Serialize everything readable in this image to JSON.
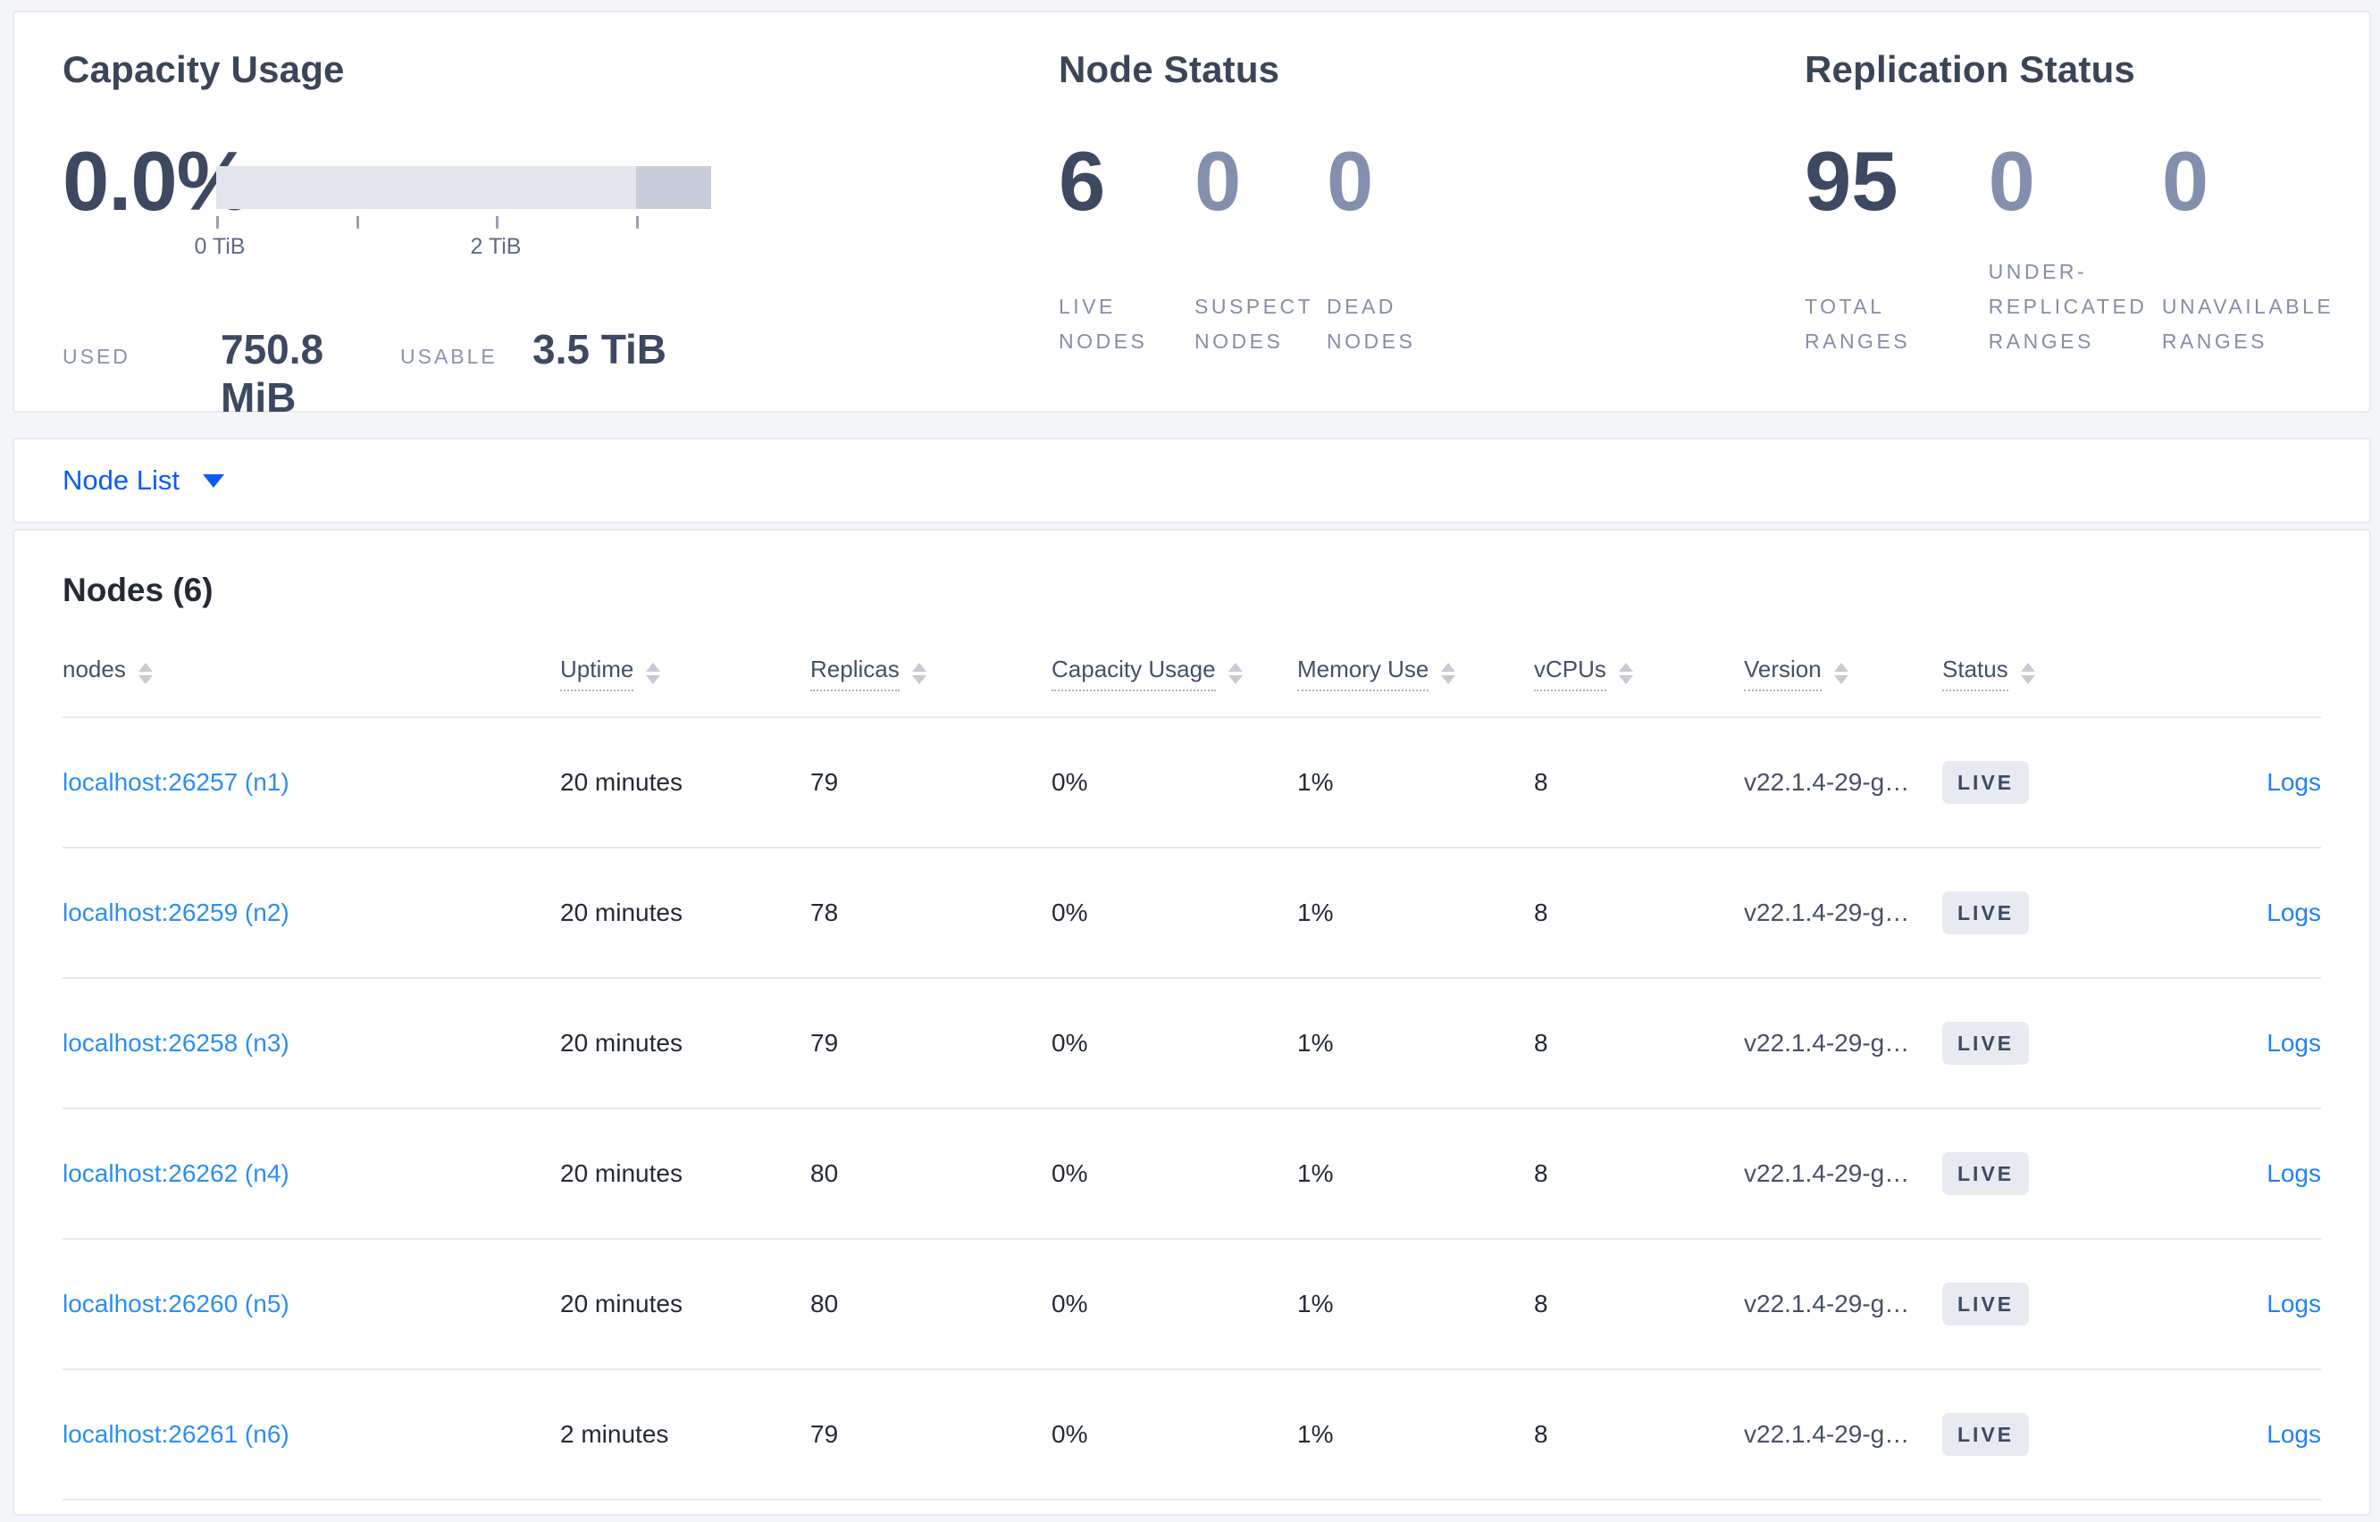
{
  "summary": {
    "capacity": {
      "title": "Capacity Usage",
      "percent": "0.0%",
      "axis_labels": [
        "0 TiB",
        "2 TiB"
      ],
      "used_label": "USED",
      "used_value": "750.8 MiB",
      "usable_label": "USABLE",
      "usable_value": "3.5 TiB"
    },
    "node_status": {
      "title": "Node Status",
      "stats": [
        {
          "value": "6",
          "label": "LIVE NODES",
          "muted": false
        },
        {
          "value": "0",
          "label": "SUSPECT NODES",
          "muted": true
        },
        {
          "value": "0",
          "label": "DEAD NODES",
          "muted": true
        }
      ]
    },
    "replication": {
      "title": "Replication Status",
      "stats": [
        {
          "value": "95",
          "label": "TOTAL RANGES",
          "muted": false
        },
        {
          "value": "0",
          "label": "UNDER-REPLICATED RANGES",
          "muted": true
        },
        {
          "value": "0",
          "label": "UNAVAILABLE RANGES",
          "muted": true
        }
      ]
    }
  },
  "nodelist": {
    "label": "Node List"
  },
  "table": {
    "heading": "Nodes (6)",
    "columns": [
      {
        "key": "node",
        "label": "nodes",
        "underline": false,
        "sortable": true
      },
      {
        "key": "uptime",
        "label": "Uptime",
        "underline": true,
        "sortable": true
      },
      {
        "key": "replicas",
        "label": "Replicas",
        "underline": true,
        "sortable": true
      },
      {
        "key": "capacity",
        "label": "Capacity Usage",
        "underline": true,
        "sortable": true
      },
      {
        "key": "memory",
        "label": "Memory Use",
        "underline": true,
        "sortable": true
      },
      {
        "key": "vcpus",
        "label": "vCPUs",
        "underline": true,
        "sortable": true
      },
      {
        "key": "version",
        "label": "Version",
        "underline": true,
        "sortable": true
      },
      {
        "key": "status",
        "label": "Status",
        "underline": true,
        "sortable": true
      },
      {
        "key": "logs",
        "label": "",
        "underline": false,
        "sortable": false
      }
    ],
    "rows": [
      {
        "node": "localhost:26257 (n1)",
        "uptime": "20 minutes",
        "replicas": "79",
        "capacity": "0%",
        "memory": "1%",
        "vcpus": "8",
        "version": "v22.1.4-29-g…",
        "status": "LIVE",
        "logs": "Logs"
      },
      {
        "node": "localhost:26259 (n2)",
        "uptime": "20 minutes",
        "replicas": "78",
        "capacity": "0%",
        "memory": "1%",
        "vcpus": "8",
        "version": "v22.1.4-29-g…",
        "status": "LIVE",
        "logs": "Logs"
      },
      {
        "node": "localhost:26258 (n3)",
        "uptime": "20 minutes",
        "replicas": "79",
        "capacity": "0%",
        "memory": "1%",
        "vcpus": "8",
        "version": "v22.1.4-29-g…",
        "status": "LIVE",
        "logs": "Logs"
      },
      {
        "node": "localhost:26262 (n4)",
        "uptime": "20 minutes",
        "replicas": "80",
        "capacity": "0%",
        "memory": "1%",
        "vcpus": "8",
        "version": "v22.1.4-29-g…",
        "status": "LIVE",
        "logs": "Logs"
      },
      {
        "node": "localhost:26260 (n5)",
        "uptime": "20 minutes",
        "replicas": "80",
        "capacity": "0%",
        "memory": "1%",
        "vcpus": "8",
        "version": "v22.1.4-29-g…",
        "status": "LIVE",
        "logs": "Logs"
      },
      {
        "node": "localhost:26261 (n6)",
        "uptime": "2 minutes",
        "replicas": "79",
        "capacity": "0%",
        "memory": "1%",
        "vcpus": "8",
        "version": "v22.1.4-29-g…",
        "status": "LIVE",
        "logs": "Logs"
      }
    ]
  },
  "colors": {
    "page_bg": "#f3f5f9",
    "card_border": "#e7e9f0",
    "heading_text": "#3b4558",
    "stat_number": "#3d4961",
    "stat_number_muted": "#8290ad",
    "label_muted": "#848ea6",
    "row_link_blue": "#2b8ef2",
    "nodelist_blue": "#0b5cf5",
    "badge_bg": "#e7eaf0",
    "badge_text": "#3d4b63",
    "bar_fill": "#e3e5ec",
    "bar_extra": "#c9cdd9",
    "divider": "#e7e9ef"
  }
}
